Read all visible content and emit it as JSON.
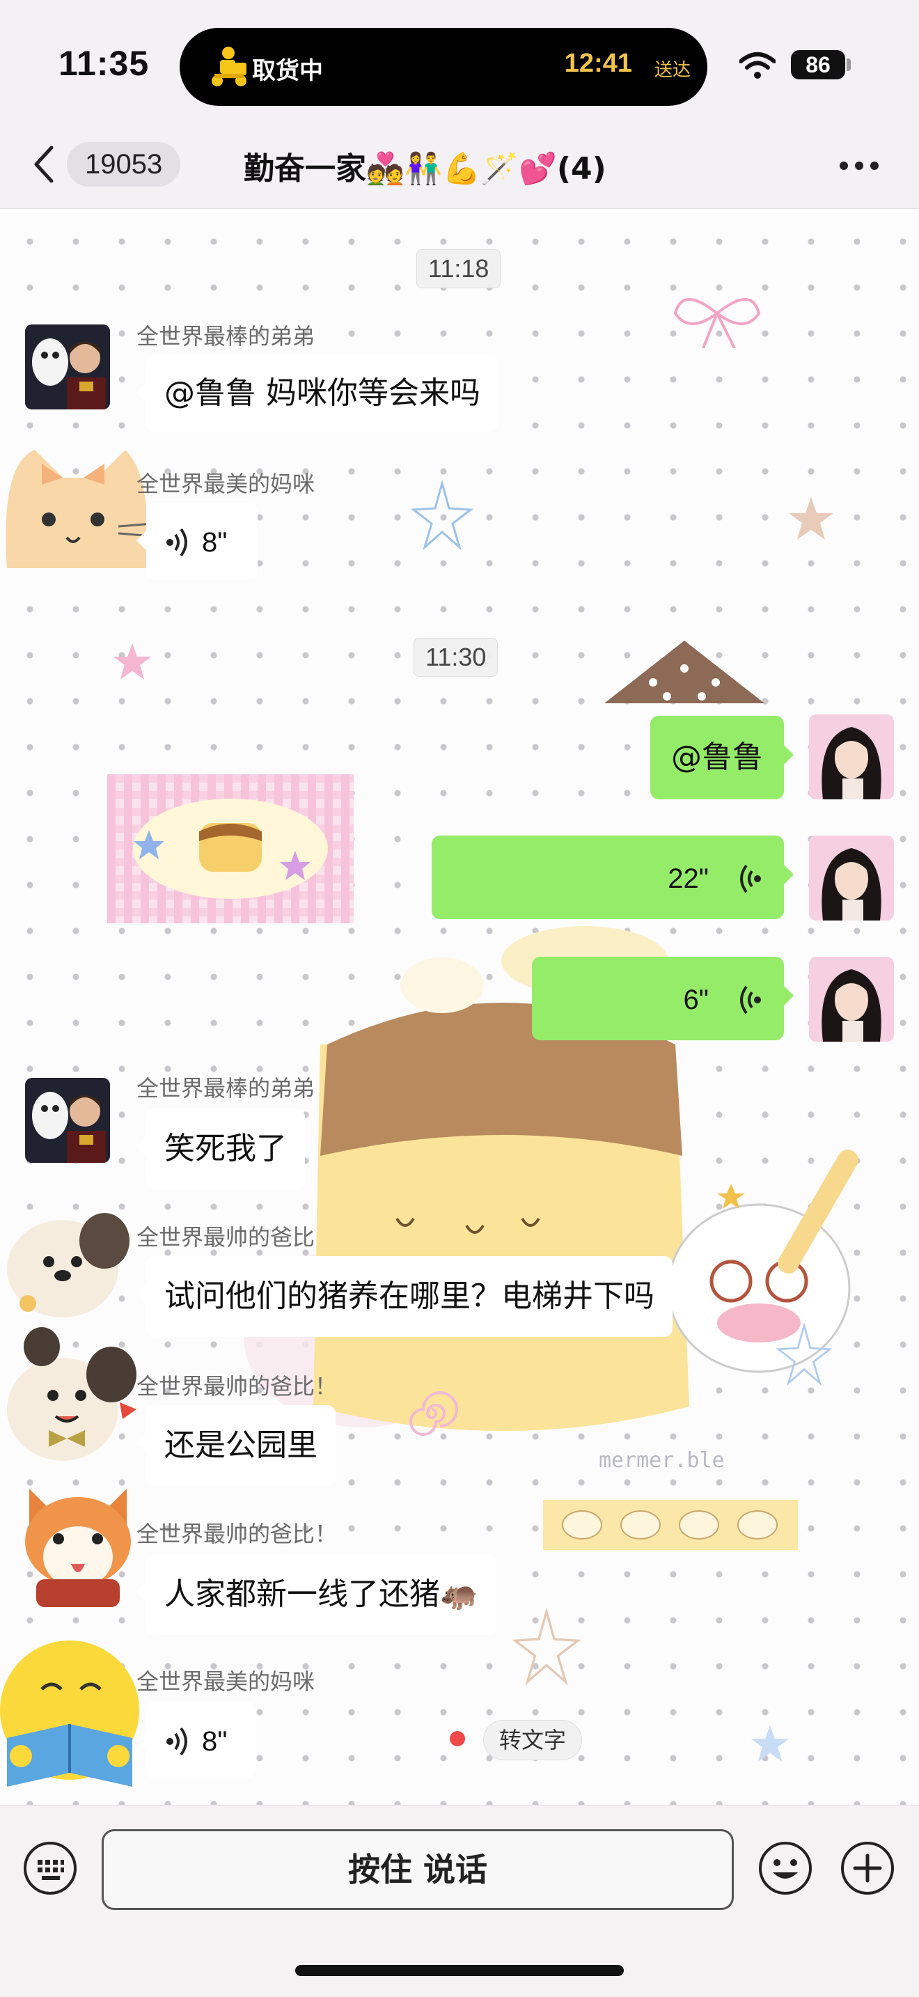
{
  "status_bar": {
    "time": "11:35",
    "live_activity": {
      "label": "取货中",
      "eta": "12:41",
      "eta_suffix": "送达"
    },
    "battery": "86"
  },
  "nav": {
    "back_count": "19053",
    "title": "勤奋一家💑👫💪🪄💕(4)"
  },
  "messages": {
    "ts1": "11:18",
    "m1": {
      "sender": "全世界最棒的弟弟",
      "text": "@鲁鲁 妈咪你等会来吗"
    },
    "m2": {
      "sender": "全世界最美的妈咪",
      "duration": "8\""
    },
    "ts2": "11:30",
    "m3": {
      "text": "@鲁鲁"
    },
    "m4": {
      "duration": "22\""
    },
    "m5": {
      "duration": "6\""
    },
    "m6": {
      "sender": "全世界最棒的弟弟",
      "text": "笑死我了"
    },
    "m7": {
      "sender": "全世界最帅的爸比",
      "text": "试问他们的猪养在哪里？电梯井下吗"
    },
    "m8": {
      "sender": "全世界最帅的爸比！",
      "text": "还是公园里"
    },
    "m9": {
      "sender": "全世界最帅的爸比！",
      "text": "人家都新一线了还猪🦛"
    },
    "m10": {
      "sender": "全世界最美的妈咪",
      "duration": "8\"",
      "convert_label": "转文字"
    }
  },
  "wallpaper_watermark": "mermer.ble",
  "bottom": {
    "talk_label": "按住 说话"
  },
  "colors": {
    "outgoing_bubble": "#95ec69",
    "incoming_bubble": "#ffffff",
    "unread_dot": "#f04848",
    "eta": "#f3c44b"
  }
}
